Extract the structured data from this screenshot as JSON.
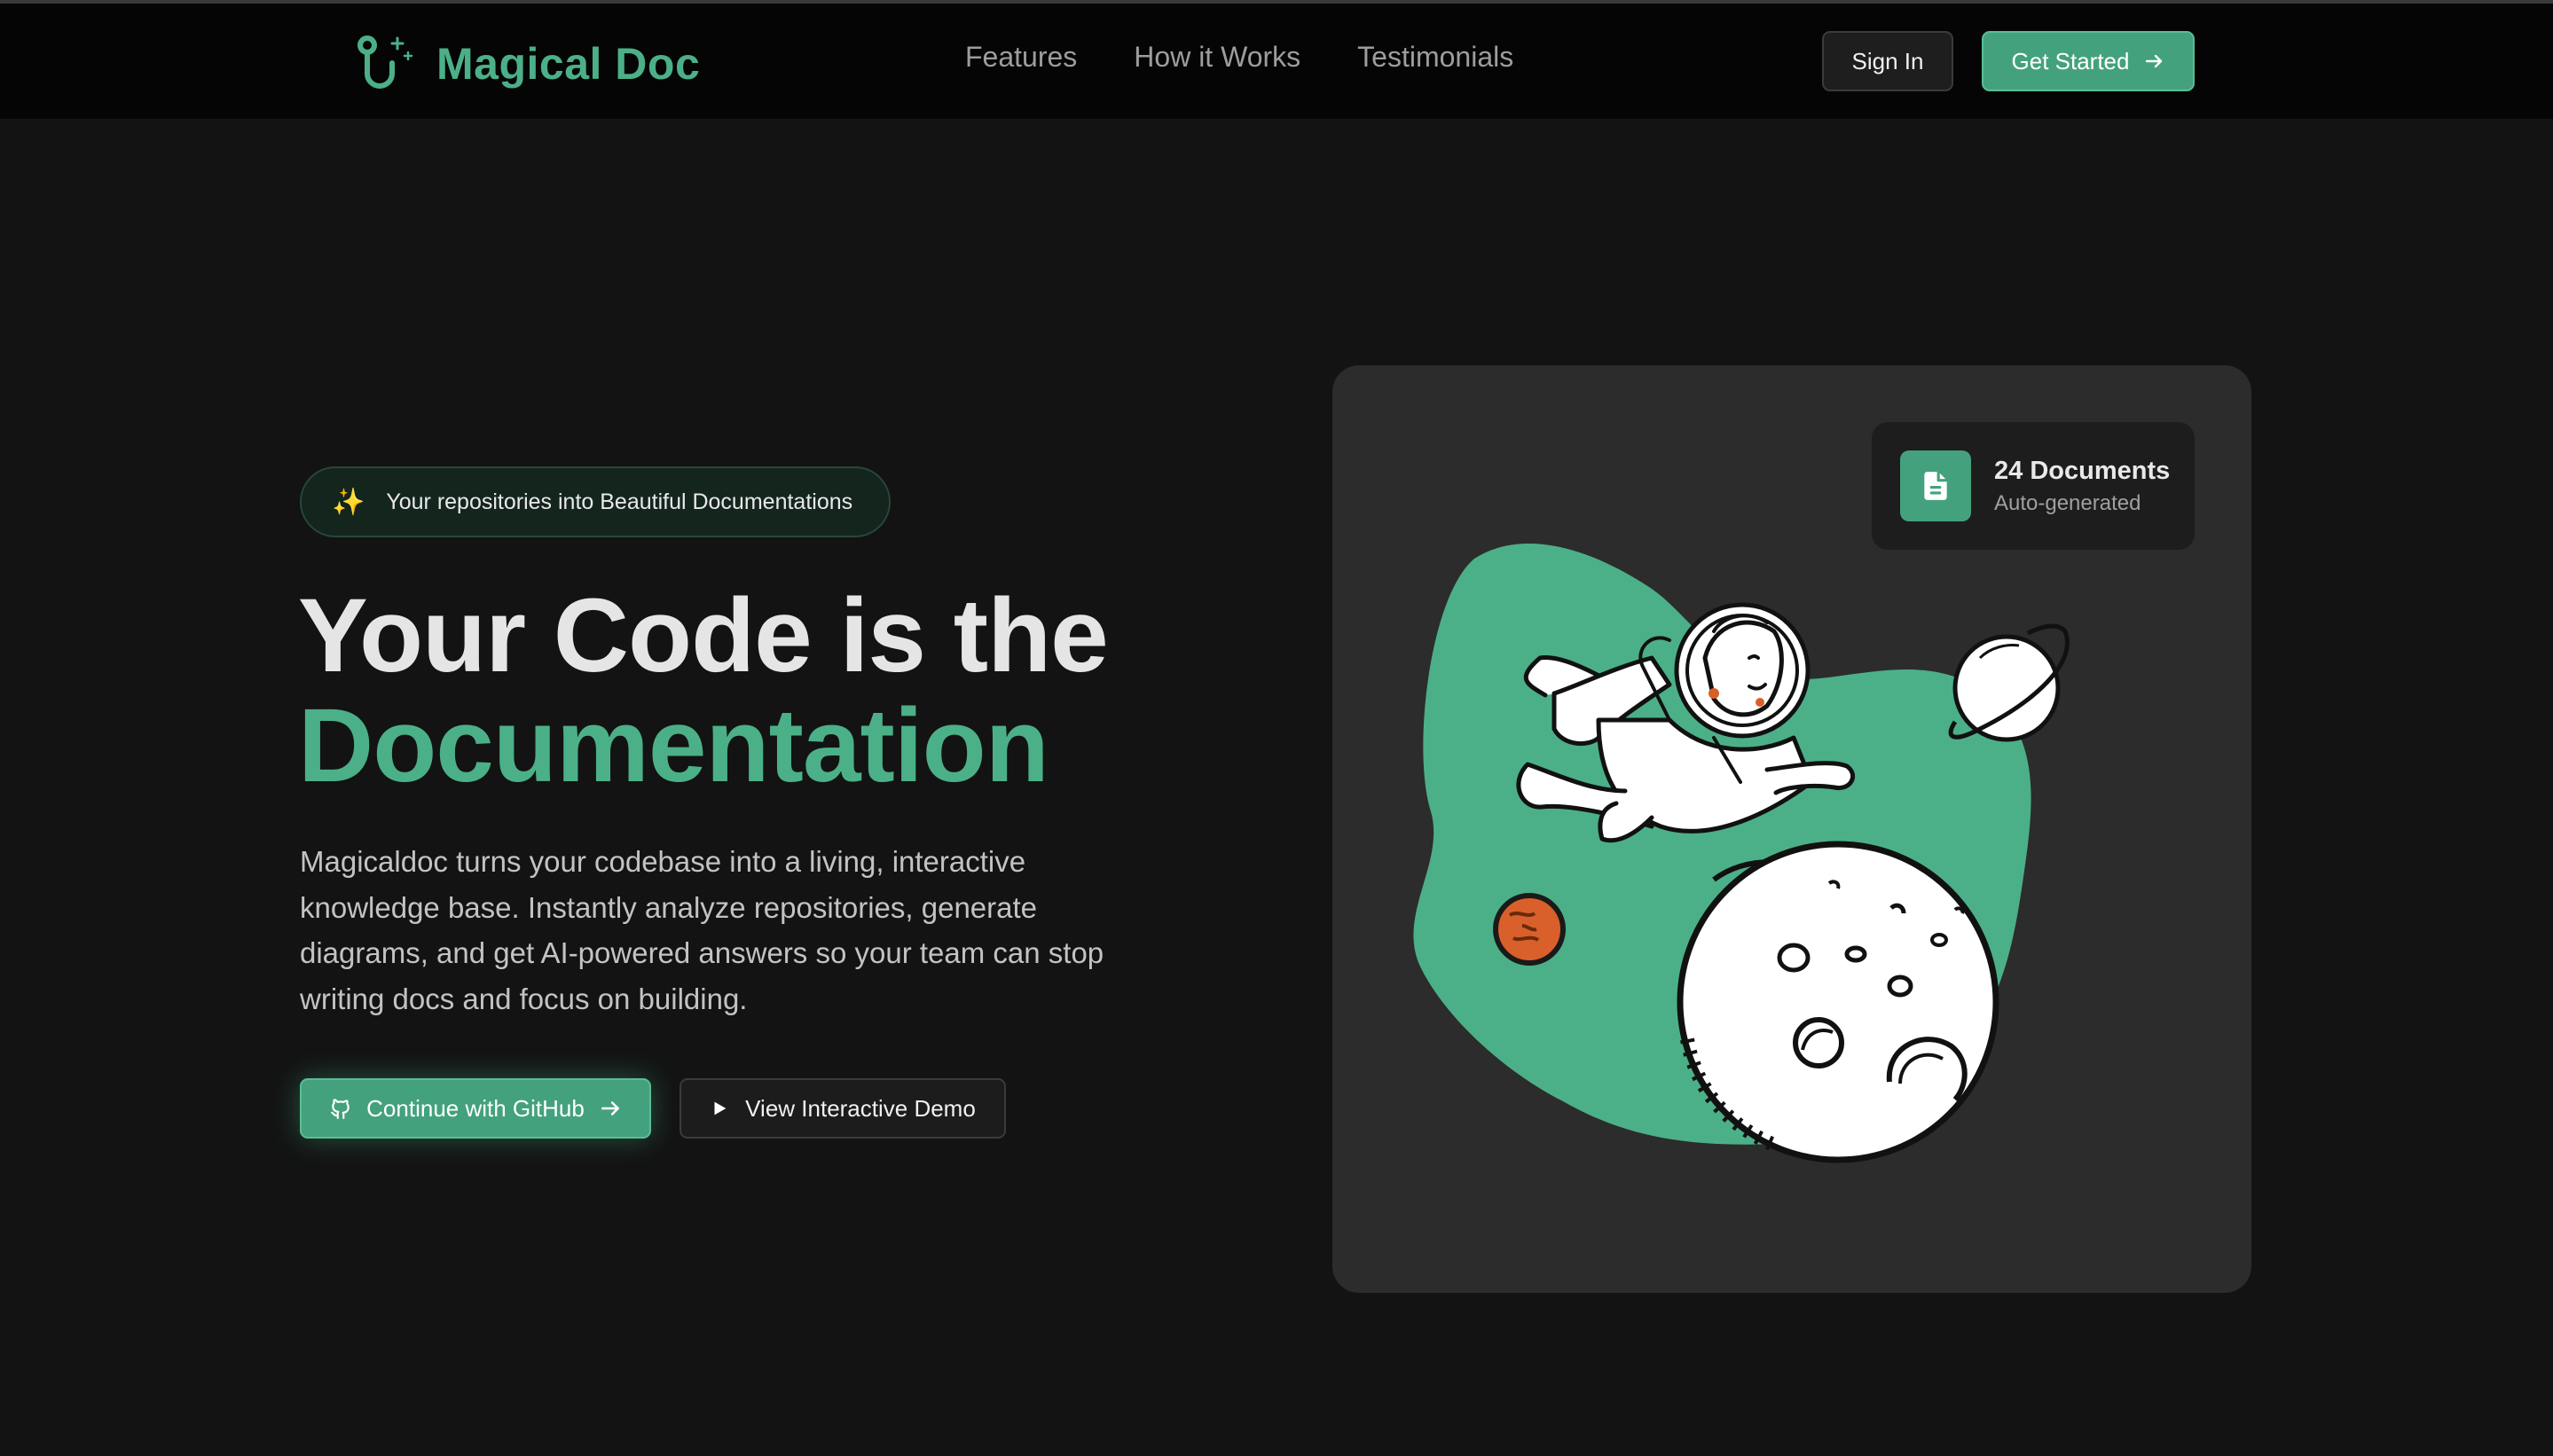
{
  "header": {
    "brand": "Magical Doc",
    "logo_icon": "git-branch-sparkle-icon",
    "nav": [
      {
        "label": "Features"
      },
      {
        "label": "How it Works"
      },
      {
        "label": "Testimonials"
      }
    ],
    "sign_in_label": "Sign In",
    "get_started_label": "Get Started"
  },
  "hero": {
    "badge_icon": "✨",
    "badge_text": "Your repositories into Beautiful Documentations",
    "headline_line1": "Your Code is the",
    "headline_line2": "Documentation",
    "description": "Magicaldoc turns your codebase into a living, interactive knowledge base. Instantly analyze repositories, generate diagrams, and get AI-powered answers so your team can stop writing docs and focus on building.",
    "primary_cta": "Continue with GitHub",
    "secondary_cta": "View Interactive Demo"
  },
  "illustration": {
    "doc_card_title": "24 Documents",
    "doc_card_subtitle": "Auto-generated"
  },
  "colors": {
    "accent": "#43a27d",
    "accent_text": "#4bb088",
    "background": "#131313",
    "header_bg": "#050505",
    "card_bg": "#2c2c2c"
  }
}
